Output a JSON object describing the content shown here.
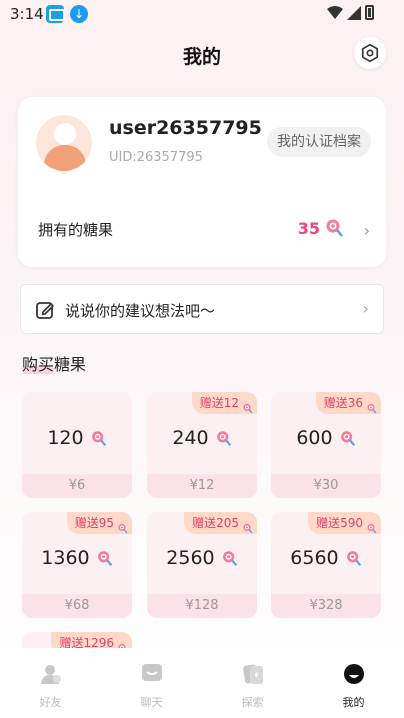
{
  "status_bar": {
    "time": "3:14"
  },
  "header": {
    "title": "我的"
  },
  "profile": {
    "username": "user26357795",
    "uid": "UID:26357795",
    "cert_button": "我的认证档案",
    "candy_label": "拥有的糖果",
    "candy_count": "35"
  },
  "suggestion": {
    "text": "说说你的建议想法吧～"
  },
  "buy_section": {
    "title": "购买糖果"
  },
  "packages": [
    {
      "amount": "120",
      "price": "¥6",
      "bonus": ""
    },
    {
      "amount": "240",
      "price": "¥12",
      "bonus": "赠送12"
    },
    {
      "amount": "600",
      "price": "¥30",
      "bonus": "赠送36"
    },
    {
      "amount": "1360",
      "price": "¥68",
      "bonus": "赠送95"
    },
    {
      "amount": "2560",
      "price": "¥128",
      "bonus": "赠送205"
    },
    {
      "amount": "6560",
      "price": "¥328",
      "bonus": "赠送590"
    },
    {
      "amount": "",
      "price": "",
      "bonus": "赠送1296"
    }
  ],
  "nav": [
    {
      "label": "好友",
      "icon": "friends-icon",
      "active": false
    },
    {
      "label": "聊天",
      "icon": "chat-icon",
      "active": false
    },
    {
      "label": "探索",
      "icon": "explore-icon",
      "active": false
    },
    {
      "label": "我的",
      "icon": "me-icon",
      "active": true
    }
  ],
  "colors": {
    "accent": "#e9497a",
    "card_bg": "#fdf0f2",
    "price_bg": "#fbe2e8",
    "bonus_bg": "#ffd9c8"
  }
}
